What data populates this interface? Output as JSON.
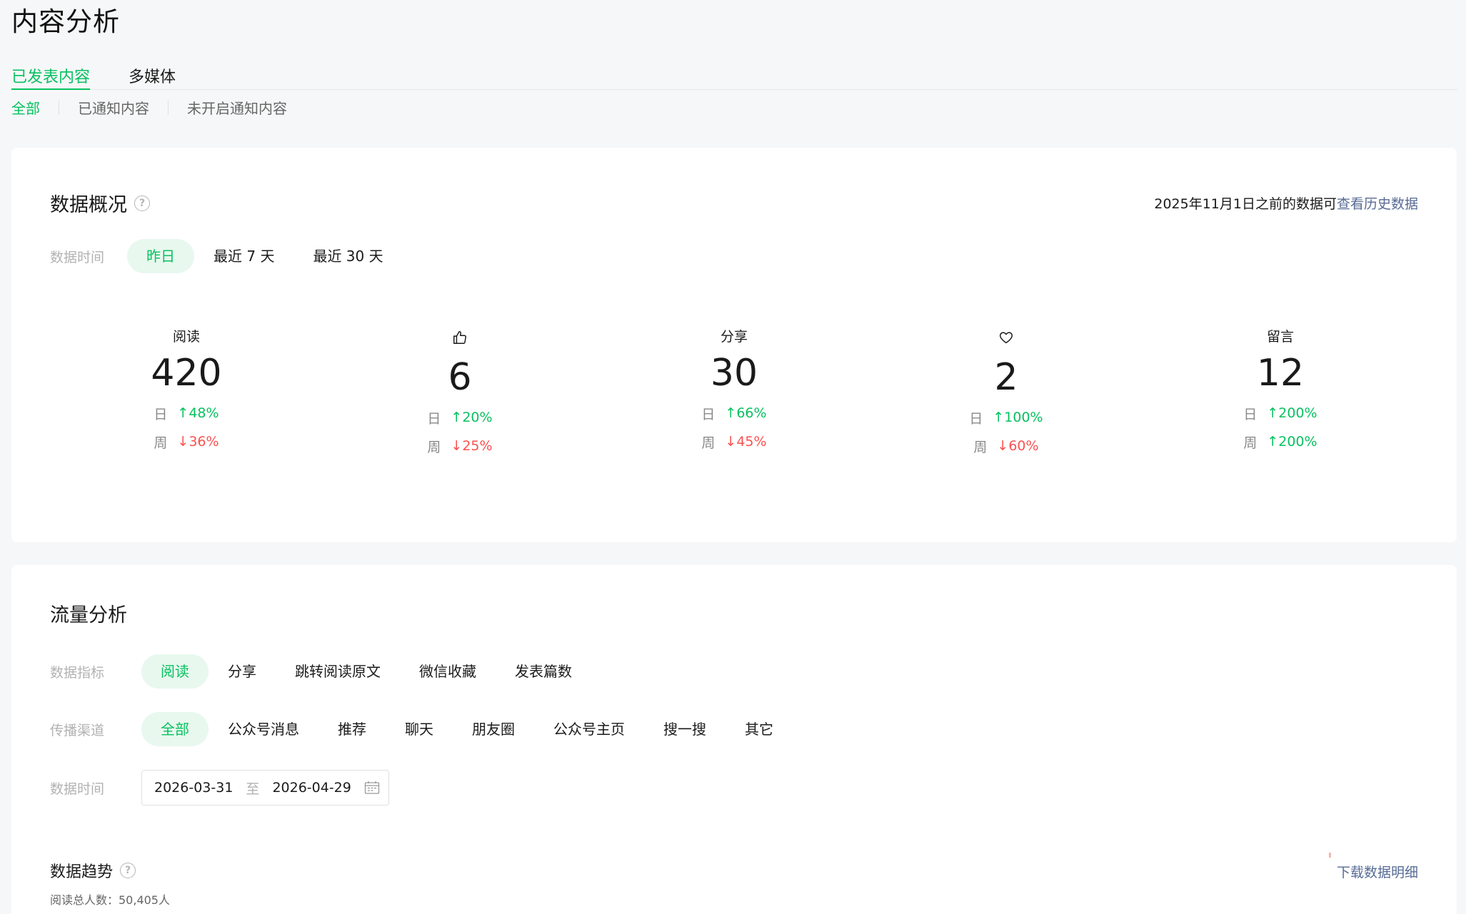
{
  "page": {
    "title": "内容分析"
  },
  "tabs": [
    "已发表内容",
    "多媒体"
  ],
  "subtabs": [
    "全部",
    "已通知内容",
    "未开启通知内容"
  ],
  "overview": {
    "title": "数据概况",
    "history_prefix": "2025年11月1日之前的数据可",
    "history_link": "查看历史数据",
    "time_label": "数据时间",
    "time_options": [
      "昨日",
      "最近 7 天",
      "最近 30 天"
    ],
    "stats": [
      {
        "label": "阅读",
        "icon": "",
        "value": "420",
        "day_label": "日",
        "day_dir": "up",
        "day_arrow": "↑",
        "day": "48%",
        "week_label": "周",
        "week_dir": "down",
        "week_arrow": "↓",
        "week": "36%"
      },
      {
        "label": "",
        "icon": "thumbs-up-icon",
        "value": "6",
        "day_label": "日",
        "day_dir": "up",
        "day_arrow": "↑",
        "day": "20%",
        "week_label": "周",
        "week_dir": "down",
        "week_arrow": "↓",
        "week": "25%"
      },
      {
        "label": "分享",
        "icon": "",
        "value": "30",
        "day_label": "日",
        "day_dir": "up",
        "day_arrow": "↑",
        "day": "66%",
        "week_label": "周",
        "week_dir": "down",
        "week_arrow": "↓",
        "week": "45%"
      },
      {
        "label": "",
        "icon": "heart-icon",
        "value": "2",
        "day_label": "日",
        "day_dir": "up",
        "day_arrow": "↑",
        "day": "100%",
        "week_label": "周",
        "week_dir": "down",
        "week_arrow": "↓",
        "week": "60%"
      },
      {
        "label": "留言",
        "icon": "",
        "value": "12",
        "day_label": "日",
        "day_dir": "up",
        "day_arrow": "↑",
        "day": "200%",
        "week_label": "周",
        "week_dir": "up",
        "week_arrow": "↑",
        "week": "200%"
      }
    ]
  },
  "traffic": {
    "title": "流量分析",
    "metric_label": "数据指标",
    "metrics": [
      "阅读",
      "分享",
      "跳转阅读原文",
      "微信收藏",
      "发表篇数"
    ],
    "channel_label": "传播渠道",
    "channels": [
      "全部",
      "公众号消息",
      "推荐",
      "聊天",
      "朋友圈",
      "公众号主页",
      "搜一搜",
      "其它"
    ],
    "time_label": "数据时间",
    "date_start": "2026-03-31",
    "date_sep": "至",
    "date_end": "2026-04-29",
    "trend_title": "数据趋势",
    "trend_sub": "阅读总人数：50,405人",
    "download_link": "下载数据明细"
  },
  "colors": {
    "accent": "#07c160",
    "up": "#07c160",
    "down": "#fa5151",
    "link": "#576b95"
  }
}
